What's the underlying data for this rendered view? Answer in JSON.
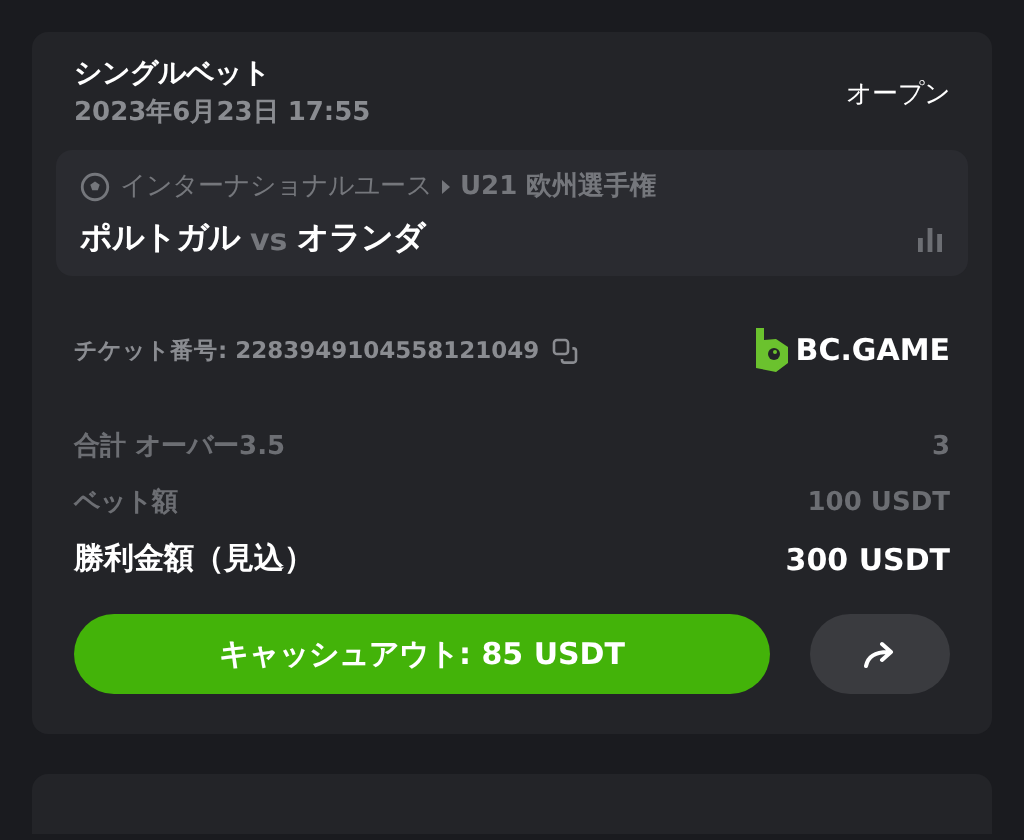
{
  "bet": {
    "type": "シングルベット",
    "date": "2023年6月23日 17:55",
    "status": "オープン"
  },
  "event": {
    "league": "インターナショナルユース",
    "tournament": "U21 欧州選手権",
    "home": "ポルトガル",
    "vs": "vs",
    "away": "オランダ"
  },
  "ticket": {
    "label": "チケット番号: 2283949104558121049",
    "brand": "BC.GAME"
  },
  "summary": [
    {
      "label": "合計 オーバー3.5",
      "value": "3",
      "emphasis": false
    },
    {
      "label": "ベット額",
      "value": "100 USDT",
      "emphasis": false
    },
    {
      "label": "勝利金額（見込）",
      "value": "300 USDT",
      "emphasis": true
    }
  ],
  "cashout_button": "キャッシュアウト: 85 USDT"
}
